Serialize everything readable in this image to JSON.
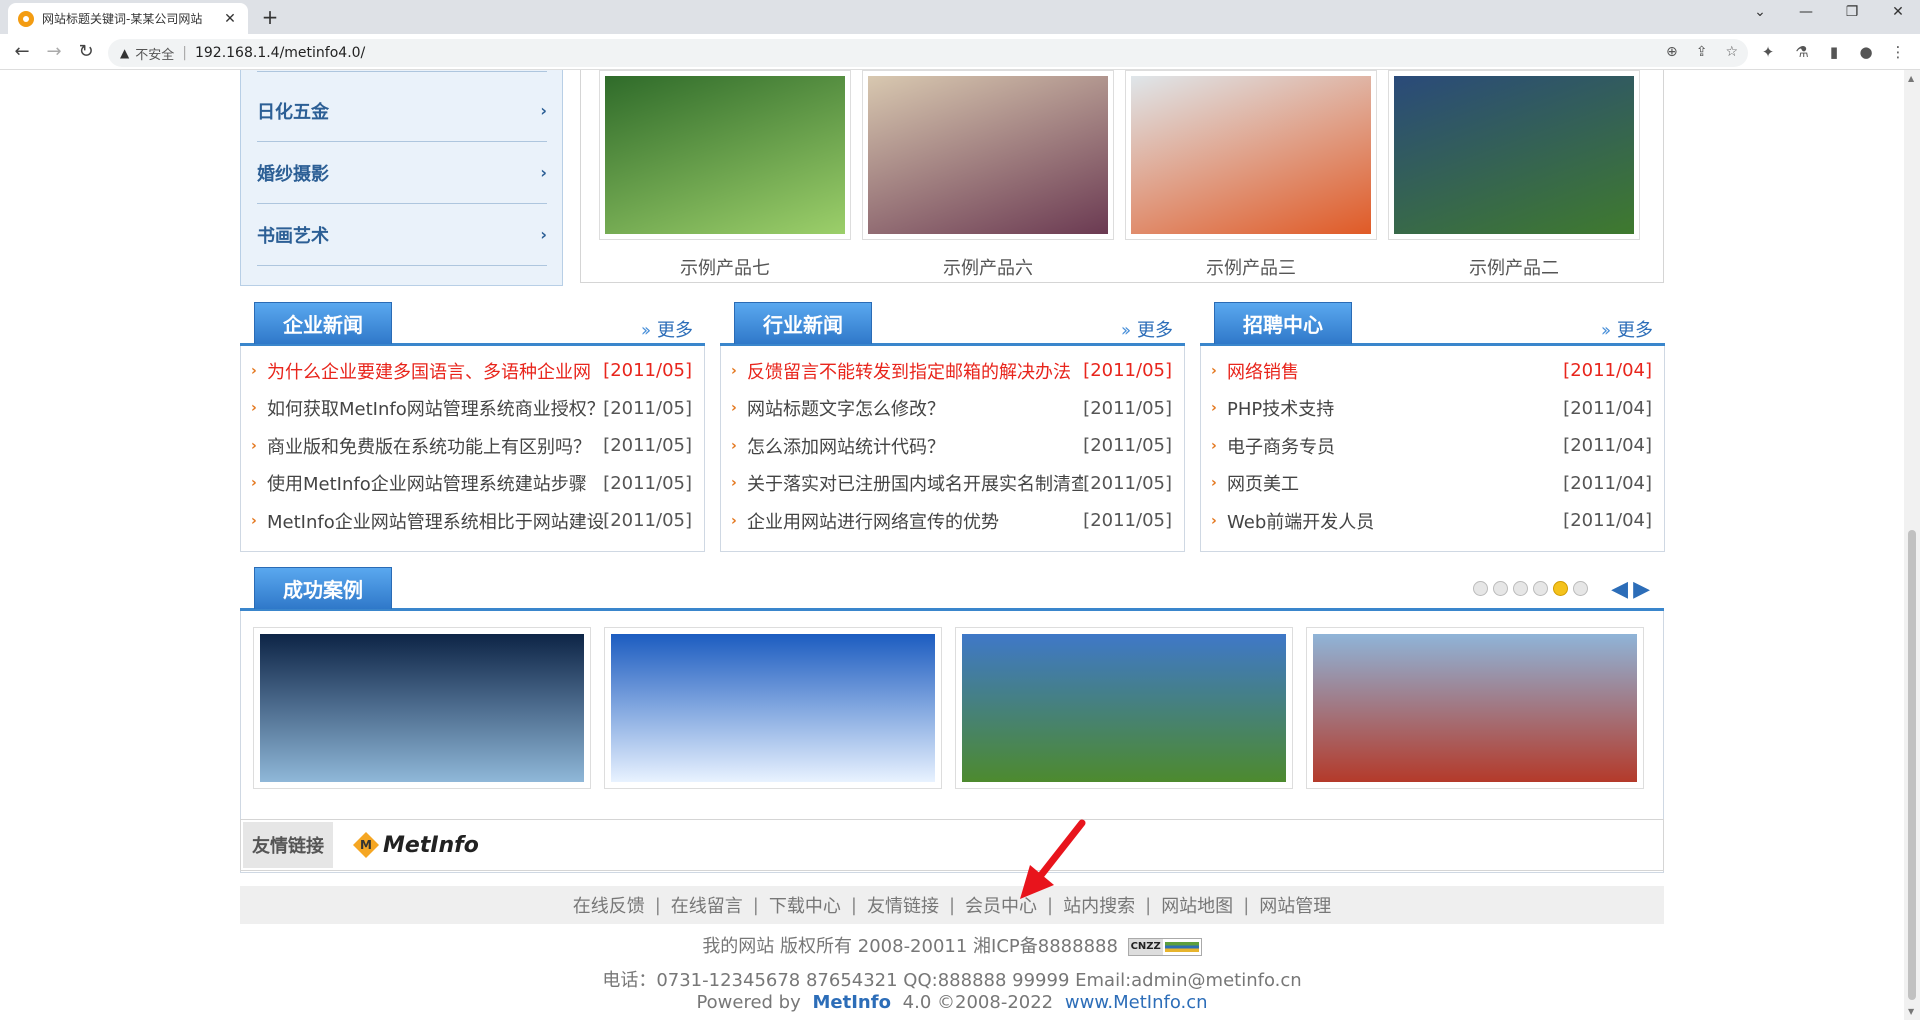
{
  "browser": {
    "tab_title": "网站标题关键词-某某公司网站",
    "close_glyph": "✕",
    "new_tab_glyph": "+",
    "address_warning": "不安全",
    "url": "192.168.1.4/metinfo4.0/"
  },
  "categories": [
    {
      "label": "日化五金"
    },
    {
      "label": "婚纱摄影"
    },
    {
      "label": "书画艺术"
    }
  ],
  "products": [
    {
      "name": "示例产品七",
      "colors": [
        "#2f6b2a",
        "#9ccf6a"
      ]
    },
    {
      "name": "示例产品六",
      "colors": [
        "#d8c8b0",
        "#6b3a52"
      ]
    },
    {
      "name": "示例产品三",
      "colors": [
        "#dfe6ea",
        "#e05a26"
      ]
    },
    {
      "name": "示例产品二",
      "colors": [
        "#2a4a7a",
        "#3f7a2e"
      ]
    }
  ],
  "news": [
    {
      "title": "企业新闻",
      "more": "更多",
      "items": [
        {
          "title": "为什么企业要建多国语言、多语种企业网",
          "date": "[2011/05]",
          "hot": true
        },
        {
          "title": "如何获取MetInfo网站管理系统商业授权？",
          "date": "[2011/05]",
          "hot": false
        },
        {
          "title": "商业版和免费版在系统功能上有区别吗？",
          "date": "[2011/05]",
          "hot": false
        },
        {
          "title": "使用MetInfo企业网站管理系统建站步骤",
          "date": "[2011/05]",
          "hot": false
        },
        {
          "title": "MetInfo企业网站管理系统相比于网站建设公",
          "date": "[2011/05]",
          "hot": false
        }
      ]
    },
    {
      "title": "行业新闻",
      "more": "更多",
      "items": [
        {
          "title": "反馈留言不能转发到指定邮箱的解决办法",
          "date": "[2011/05]",
          "hot": true
        },
        {
          "title": "网站标题文字怎么修改？",
          "date": "[2011/05]",
          "hot": false
        },
        {
          "title": "怎么添加网站统计代码？",
          "date": "[2011/05]",
          "hot": false
        },
        {
          "title": "关于落实对已注册国内域名开展实名制清查",
          "date": "[2011/05]",
          "hot": false
        },
        {
          "title": "企业用网站进行网络宣传的优势",
          "date": "[2011/05]",
          "hot": false
        }
      ]
    },
    {
      "title": "招聘中心",
      "more": "更多",
      "items": [
        {
          "title": "网络销售",
          "date": "[2011/04]",
          "hot": true
        },
        {
          "title": "PHP技术支持",
          "date": "[2011/04]",
          "hot": false
        },
        {
          "title": "电子商务专员",
          "date": "[2011/04]",
          "hot": false
        },
        {
          "title": "网页美工",
          "date": "[2011/04]",
          "hot": false
        },
        {
          "title": "Web前端开发人员",
          "date": "[2011/04]",
          "hot": false
        }
      ]
    }
  ],
  "cases": {
    "title": "成功案例",
    "dot_count": 6,
    "active_dot": 5,
    "images": [
      {
        "colors": [
          "#0d2446",
          "#8fb7d8"
        ]
      },
      {
        "colors": [
          "#1c5cc0",
          "#e8f2ff"
        ]
      },
      {
        "colors": [
          "#3f78c8",
          "#4d8a2e"
        ]
      },
      {
        "colors": [
          "#8fb4d8",
          "#b43a2a"
        ]
      }
    ]
  },
  "friend_links": {
    "label": "友情链接",
    "logo_letter": "M",
    "logo_text": "MetInfo"
  },
  "footer": {
    "nav": [
      "在线反馈",
      "在线留言",
      "下载中心",
      "友情链接",
      "会员中心",
      "站内搜索",
      "网站地图",
      "网站管理"
    ],
    "separator": "|",
    "copyright": "我的网站 版权所有 2008-20011 湘ICP备8888888",
    "cnzz": "CNZZ",
    "contact": "电话：0731-12345678 87654321 QQ:888888 99999 Email:admin@metinfo.cn",
    "powered_prefix": "Powered by",
    "powered_brand": "MetInfo",
    "powered_version": "4.0 ©2008-2022",
    "powered_site": "www.MetInfo.cn"
  },
  "colors": {
    "accent_blue": "#3a86cc",
    "hot_red": "#e8251c",
    "bullet_orange": "#e4761c",
    "annotation_red": "#e8141c"
  }
}
